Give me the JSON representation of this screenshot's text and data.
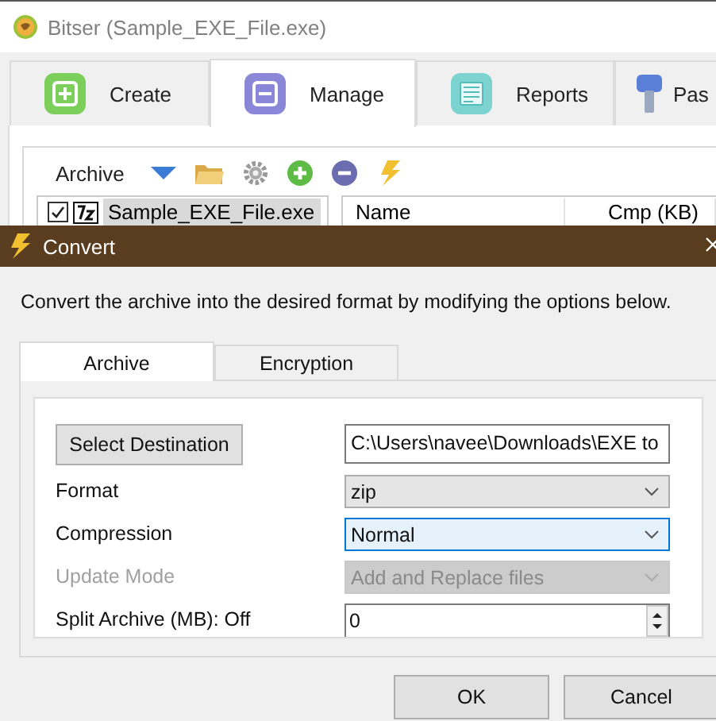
{
  "window": {
    "title": "Bitser (Sample_EXE_File.exe)"
  },
  "tabs": [
    {
      "label": "Create",
      "selected": false,
      "kind": "create"
    },
    {
      "label": "Manage",
      "selected": true,
      "kind": "manage"
    },
    {
      "label": "Reports",
      "selected": false,
      "kind": "reports"
    },
    {
      "label": "Pas",
      "selected": false,
      "kind": "passwords"
    }
  ],
  "toolbar": {
    "label": "Archive"
  },
  "archive_list": [
    {
      "name": "Sample_EXE_File.exe",
      "checked": true,
      "selected": true
    }
  ],
  "file_table": {
    "columns": [
      "Name",
      "Cmp (KB)"
    ]
  },
  "dialog": {
    "title": "Convert",
    "description": "Convert the archive into the desired format by modifying the options below.",
    "tabs": [
      {
        "label": "Archive",
        "selected": true
      },
      {
        "label": "Encryption",
        "selected": false
      }
    ],
    "destination_button": "Select Destination",
    "destination": "C:\\Users\\navee\\Downloads\\EXE to",
    "fields": [
      {
        "kind": "select",
        "label": "Format",
        "value": "zip",
        "disabled": false,
        "focused": false
      },
      {
        "kind": "select",
        "label": "Compression",
        "value": "Normal",
        "disabled": false,
        "focused": true
      },
      {
        "kind": "select",
        "label": "Update Mode",
        "value": "Add and Replace files",
        "disabled": true,
        "focused": false
      },
      {
        "kind": "spinner",
        "label": "Split Archive (MB): Off",
        "value": "0",
        "disabled": false,
        "focused": false
      }
    ],
    "buttons": [
      "OK",
      "Cancel"
    ]
  }
}
